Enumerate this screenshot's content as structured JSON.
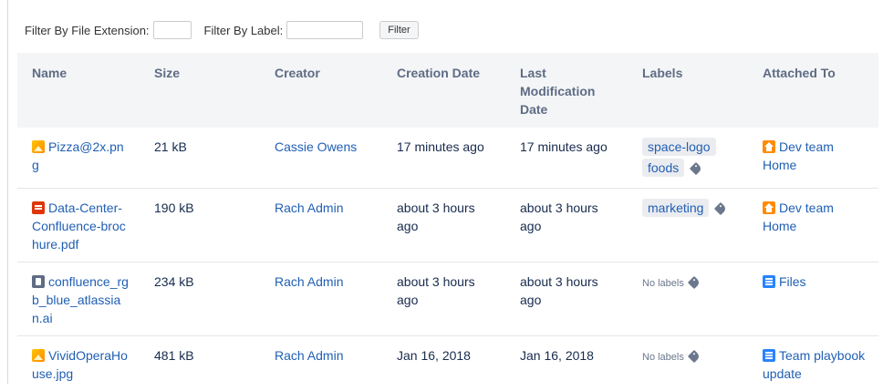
{
  "filters": {
    "extension_label": "Filter By File Extension:",
    "extension_value": "",
    "label_label": "Filter By Label:",
    "label_value": "",
    "button_label": "Filter"
  },
  "table": {
    "headers": {
      "name": "Name",
      "size": "Size",
      "creator": "Creator",
      "creation_date": "Creation Date",
      "modified": "Last Modification Date",
      "labels": "Labels",
      "attached_to": "Attached To"
    },
    "rows": [
      {
        "icon": "image-file-icon",
        "name": "Pizza@2x.png",
        "size": "21 kB",
        "creator": "Cassie Owens",
        "created": "17 minutes ago",
        "modified": "17 minutes ago",
        "labels": [
          "space-logo",
          "foods"
        ],
        "no_labels": "",
        "attached_icon": "home-icon",
        "attached_to": "Dev team Home"
      },
      {
        "icon": "pdf-file-icon",
        "name": "Data-Center-Confluence-brochure.pdf",
        "size": "190 kB",
        "creator": "Rach Admin",
        "created": "about 3 hours ago",
        "modified": "about 3 hours ago",
        "labels": [
          "marketing"
        ],
        "no_labels": "",
        "attached_icon": "home-icon",
        "attached_to": "Dev team Home"
      },
      {
        "icon": "generic-file-icon",
        "name": "confluence_rgb_blue_atlassian.ai",
        "size": "234 kB",
        "creator": "Rach Admin",
        "created": "about 3 hours ago",
        "modified": "about 3 hours ago",
        "labels": [],
        "no_labels": "No labels",
        "attached_icon": "page-icon",
        "attached_to": "Files"
      },
      {
        "icon": "image-file-icon",
        "name": "VividOperaHouse.jpg",
        "size": "481 kB",
        "creator": "Rach Admin",
        "created": "Jan 16, 2018",
        "modified": "Jan 16, 2018",
        "labels": [],
        "no_labels": "No labels",
        "attached_icon": "page-icon",
        "attached_to": "Team playbook update"
      }
    ]
  },
  "colors": {
    "link": "#205fb3",
    "header_bg": "#f4f5f7",
    "label_bg": "#ebecf0"
  }
}
